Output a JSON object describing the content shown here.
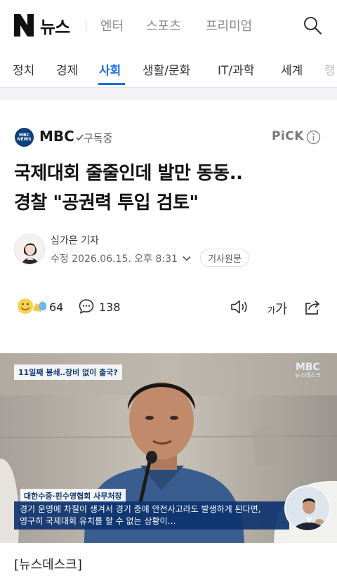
{
  "header": {
    "logo_letter": "N",
    "logo_text": "뉴스",
    "nav": [
      "엔터",
      "스포츠",
      "프리미엄"
    ]
  },
  "categories": [
    "정치",
    "경제",
    "사회",
    "생활/문화",
    "IT/과학",
    "세계",
    "랭"
  ],
  "active_category": "사회",
  "press": {
    "logo_text": "MBC NEWS",
    "name": "MBC",
    "subscribe_label": "구독중",
    "pick_label": "PiCK"
  },
  "article": {
    "headline_line1": "국제대회 줄줄인데 발만 동동..",
    "headline_line2": "경찰 \"공권력 투입 검토\"",
    "reporter": "심가은 기자",
    "updated": "수정 2026.06.15. 오후 8:31",
    "source_button": "기사원문"
  },
  "actions": {
    "reaction_count": "64",
    "comment_count": "138",
    "font_small": "가",
    "font_big": "가"
  },
  "video": {
    "top_tag": "11일째 봉쇄‥장비 없이 출국?",
    "logo_main": "MBC",
    "logo_sub": "뉴스데스크",
    "speaker_caption": "대한수중·핀수영협회 사무처장",
    "subtitle_line1": "경기 운영에 차질이 생겨서 경기 중에 안전사고라도 발생하게 된다면,",
    "subtitle_line2": "영구히 국제대회 유치를 할 수 없는 상황이…"
  },
  "body": {
    "program": "[뉴스데스크]"
  },
  "colors": {
    "accent": "#1b6fe1",
    "mbc_navy": "#0e3f7e"
  }
}
